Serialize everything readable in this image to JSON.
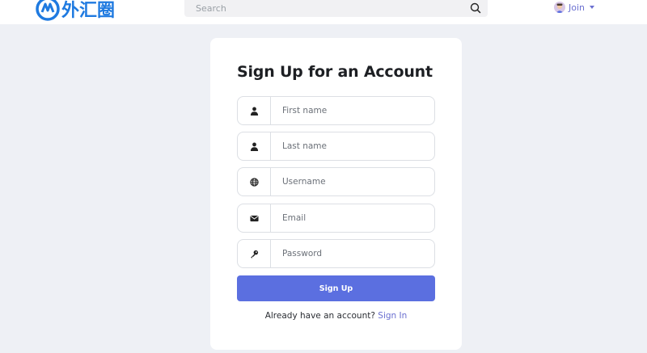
{
  "header": {
    "logo_text": "外汇圈",
    "search_placeholder": "Search",
    "join_label": "Join"
  },
  "form": {
    "title": "Sign Up for an Account",
    "fields": [
      {
        "placeholder": "First name",
        "icon": "user-icon"
      },
      {
        "placeholder": "Last name",
        "icon": "user-icon"
      },
      {
        "placeholder": "Username",
        "icon": "globe-icon"
      },
      {
        "placeholder": "Email",
        "icon": "envelope-icon"
      },
      {
        "placeholder": "Password",
        "icon": "key-icon"
      }
    ],
    "submit_label": "Sign Up",
    "signin_prompt": "Already have an account?",
    "signin_link": "Sign In"
  },
  "colors": {
    "accent": "#5b6fe0",
    "link": "#6a6fd0",
    "background": "#eef0f5",
    "logo": "#1f7ae0"
  }
}
